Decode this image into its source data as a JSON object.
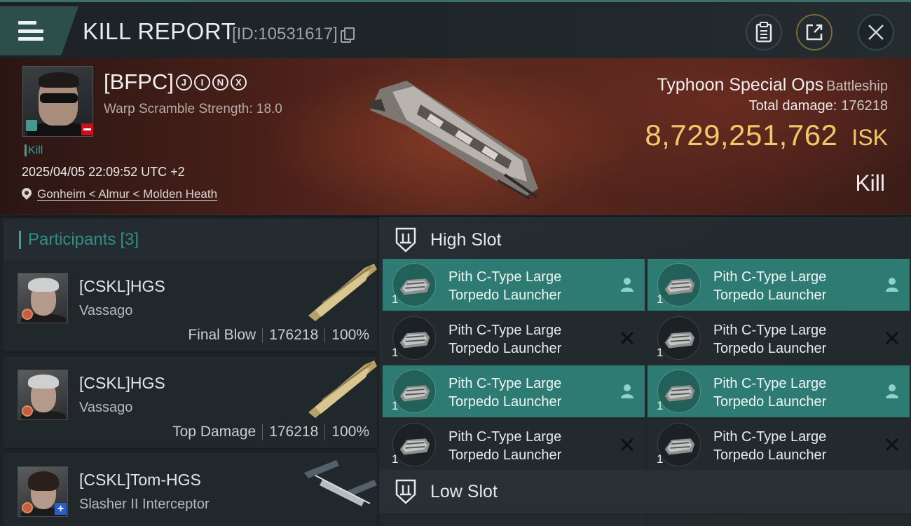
{
  "header": {
    "title": "KILL REPORT",
    "report_id": "[ID:10531617]"
  },
  "victim": {
    "name": "[BFPC]",
    "name_badges": [
      "J",
      "I",
      "N",
      "X"
    ],
    "warp_scramble": "Warp Scramble Strength: 18.0",
    "tag": "Kill",
    "timestamp": "2025/04/05 22:09:52 UTC +2",
    "location": "Gonheim < Almur < Molden Heath",
    "ship_name": "Typhoon Special Ops",
    "ship_class": "Battleship",
    "total_damage_label": "Total damage:",
    "total_damage": "176218",
    "isk_value": "8,729,251,762",
    "isk_unit": "ISK",
    "result": "Kill"
  },
  "participants": {
    "title": "Participants",
    "count": "[3]",
    "items": [
      {
        "name": "[CSKL]HGS",
        "ship": "Vassago",
        "role": "Final Blow",
        "damage": "176218",
        "percent": "100%"
      },
      {
        "name": "[CSKL]HGS",
        "ship": "Vassago",
        "role": "Top Damage",
        "damage": "176218",
        "percent": "100%"
      },
      {
        "name": "[CSKL]Tom-HGS",
        "ship": "Slasher II Interceptor",
        "role": "",
        "damage": "",
        "percent": ""
      }
    ]
  },
  "fitting": {
    "high_slot_label": "High Slot",
    "low_slot_label": "Low Slot",
    "high_slots": [
      {
        "name": "Pith C-Type Large Torpedo Launcher",
        "qty": "1",
        "status": "dropped"
      },
      {
        "name": "Pith C-Type Large Torpedo Launcher",
        "qty": "1",
        "status": "dropped"
      },
      {
        "name": "Pith C-Type Large Torpedo Launcher",
        "qty": "1",
        "status": "destroyed"
      },
      {
        "name": "Pith C-Type Large Torpedo Launcher",
        "qty": "1",
        "status": "destroyed"
      },
      {
        "name": "Pith C-Type Large Torpedo Launcher",
        "qty": "1",
        "status": "dropped"
      },
      {
        "name": "Pith C-Type Large Torpedo Launcher",
        "qty": "1",
        "status": "dropped"
      },
      {
        "name": "Pith C-Type Large Torpedo Launcher",
        "qty": "1",
        "status": "destroyed"
      },
      {
        "name": "Pith C-Type Large Torpedo Launcher",
        "qty": "1",
        "status": "destroyed"
      }
    ]
  },
  "colors": {
    "accent_teal": "#2e7b73",
    "isk_gold": "#f1c86a",
    "negative_badge": "#c5121b"
  },
  "icons": {
    "menu": "hamburger-icon",
    "copy": "copy-icon",
    "clipboard": "clipboard-icon",
    "share": "share-icon",
    "close": "close-icon",
    "location": "location-pin-icon",
    "slot": "slot-shield-icon",
    "dropped": "person-icon",
    "destroyed": "x-icon"
  }
}
